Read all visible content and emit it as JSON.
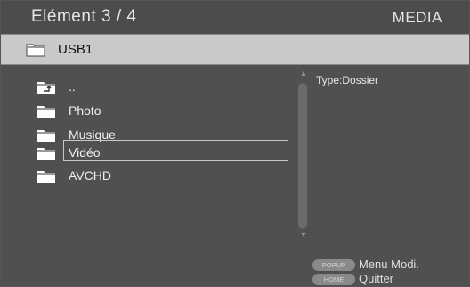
{
  "header": {
    "title": "Elément 3 / 4",
    "mode": "MEDIA"
  },
  "path": {
    "label": "USB1",
    "icon": "folder-icon"
  },
  "items": [
    {
      "label": "..",
      "icon": "parent-folder-icon"
    },
    {
      "label": "Photo",
      "icon": "folder-icon"
    },
    {
      "label": "Musique",
      "icon": "folder-icon"
    },
    {
      "label": "Vidéo",
      "icon": "folder-icon",
      "selected": true
    },
    {
      "label": "AVCHD",
      "icon": "folder-icon"
    }
  ],
  "info": {
    "type": "Type:Dossier"
  },
  "legend": [
    {
      "key": "POPUP",
      "label": "Menu Modi."
    },
    {
      "key": "HOME",
      "label": "Quitter"
    }
  ]
}
